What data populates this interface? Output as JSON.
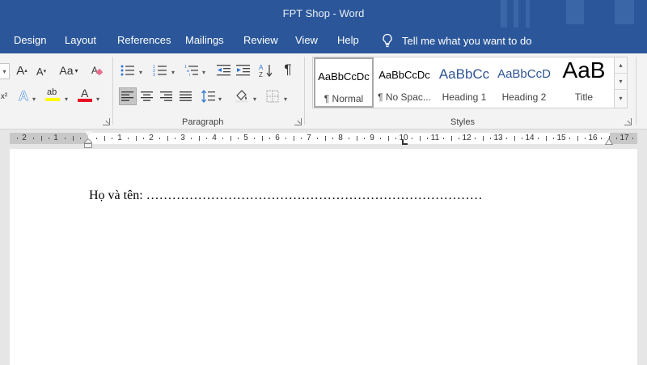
{
  "window": {
    "title": "FPT Shop  -  Word"
  },
  "menu": {
    "tabs": [
      "Design",
      "Layout",
      "References",
      "Mailings",
      "Review",
      "View",
      "Help"
    ],
    "tell_me": "Tell me what you want to do"
  },
  "ribbon": {
    "font_group": {
      "grow_label": "A",
      "shrink_label": "A",
      "case_label": "Aa",
      "text_effects_label": "A",
      "highlight_label": "ab",
      "font_color_label": "A",
      "font_color_bar": "#e81123",
      "highlight_bar": "#ffff00"
    },
    "paragraph_group": {
      "label": "Paragraph",
      "pilcrow": "¶"
    },
    "styles_group": {
      "label": "Styles",
      "styles": [
        {
          "sample": "AaBbCcDc",
          "name": "¶ Normal"
        },
        {
          "sample": "AaBbCcDc",
          "name": "¶ No Spac..."
        },
        {
          "sample": "AaBbCc",
          "name": "Heading 1"
        },
        {
          "sample": "AaBbCcD",
          "name": "Heading 2"
        },
        {
          "sample": "AaB",
          "name": "Title"
        }
      ]
    }
  },
  "ruler": {
    "left_numbers": [
      "2",
      "1"
    ],
    "numbers": [
      "1",
      "2",
      "3",
      "4",
      "5",
      "6",
      "7",
      "8",
      "9",
      "10",
      "11",
      "12",
      "13",
      "14",
      "15",
      "16",
      "17"
    ]
  },
  "document": {
    "line1": "Họ và tên: ……………………………………………………………………"
  },
  "colors": {
    "title_bar": "#2b579a",
    "ribbon_bg": "#f3f3f3",
    "page_bg": "#ffffff",
    "ruler_margin": "#c8c8c8"
  }
}
